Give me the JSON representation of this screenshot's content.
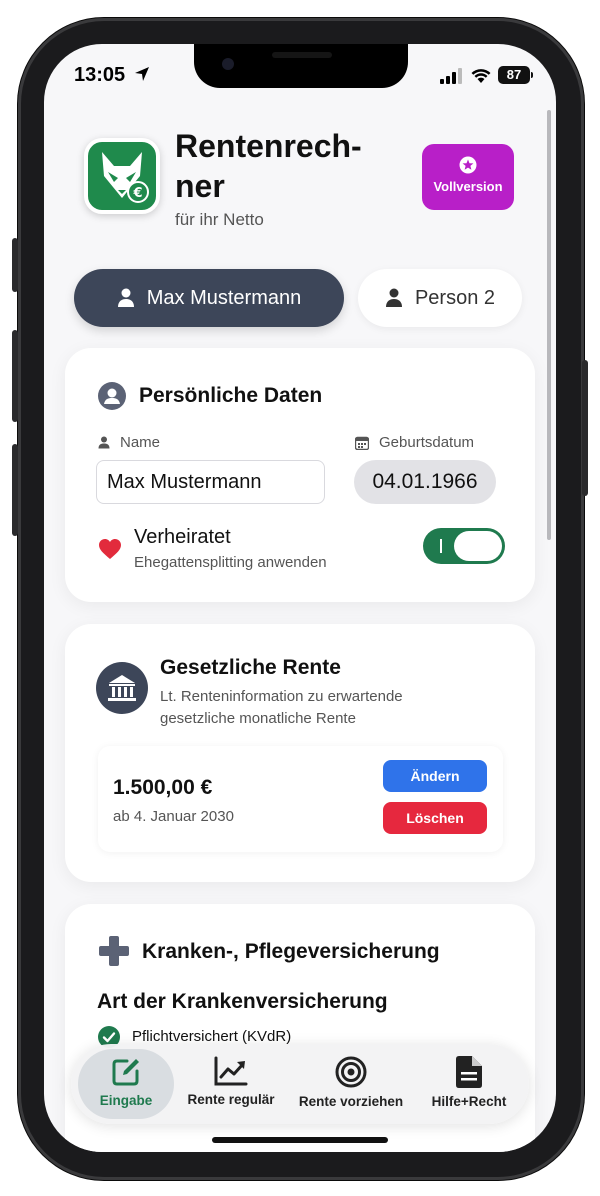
{
  "status_bar": {
    "time": "13:05",
    "battery": "87"
  },
  "header": {
    "title": "Rentenrech-ner",
    "title_line1": "Rentenrech-",
    "title_line2": "ner",
    "subtitle": "für ihr Netto",
    "upgrade_label": "Vollversion"
  },
  "person_tabs": [
    {
      "label": "Max Mustermann",
      "active": true
    },
    {
      "label": "Person 2",
      "active": false
    }
  ],
  "personal_data": {
    "title": "Persönliche Daten",
    "name_label": "Name",
    "name_value": "Max Mustermann",
    "birthdate_label": "Geburtsdatum",
    "birthdate_value": "04.01.1966",
    "married_label": "Verheiratet",
    "married_sub": "Ehegattensplitting anwenden",
    "married_on": true
  },
  "statutory_pension": {
    "title": "Gesetzliche Rente",
    "description_line1": "Lt. Renteninformation zu erwartende",
    "description_line2": "gesetzliche monatliche Rente",
    "amount": "1.500,00 €",
    "start": "ab 4. Januar 2030",
    "edit_label": "Ändern",
    "delete_label": "Löschen"
  },
  "insurance": {
    "title": "Kranken-, Pflegeversicherung",
    "subtitle": "Art der Krankenversicherung",
    "option_selected": "Pflichtversichert (KVdR)"
  },
  "bottom_nav": [
    {
      "label": "Eingabe",
      "icon": "edit-icon",
      "active": true
    },
    {
      "label": "Rente regulär",
      "icon": "chart-line-icon",
      "active": false
    },
    {
      "label": "Rente vorziehen",
      "icon": "target-icon",
      "active": false
    },
    {
      "label": "Hilfe+Recht",
      "icon": "document-icon",
      "active": false
    }
  ],
  "colors": {
    "brand_green": "#1f8a4c",
    "toggle_green": "#1f7a4e",
    "upgrade_purple": "#b81fc8",
    "tab_active": "#3d4659",
    "button_blue": "#2f73ea",
    "button_red": "#e6283e",
    "heart_red": "#e22b3c"
  }
}
